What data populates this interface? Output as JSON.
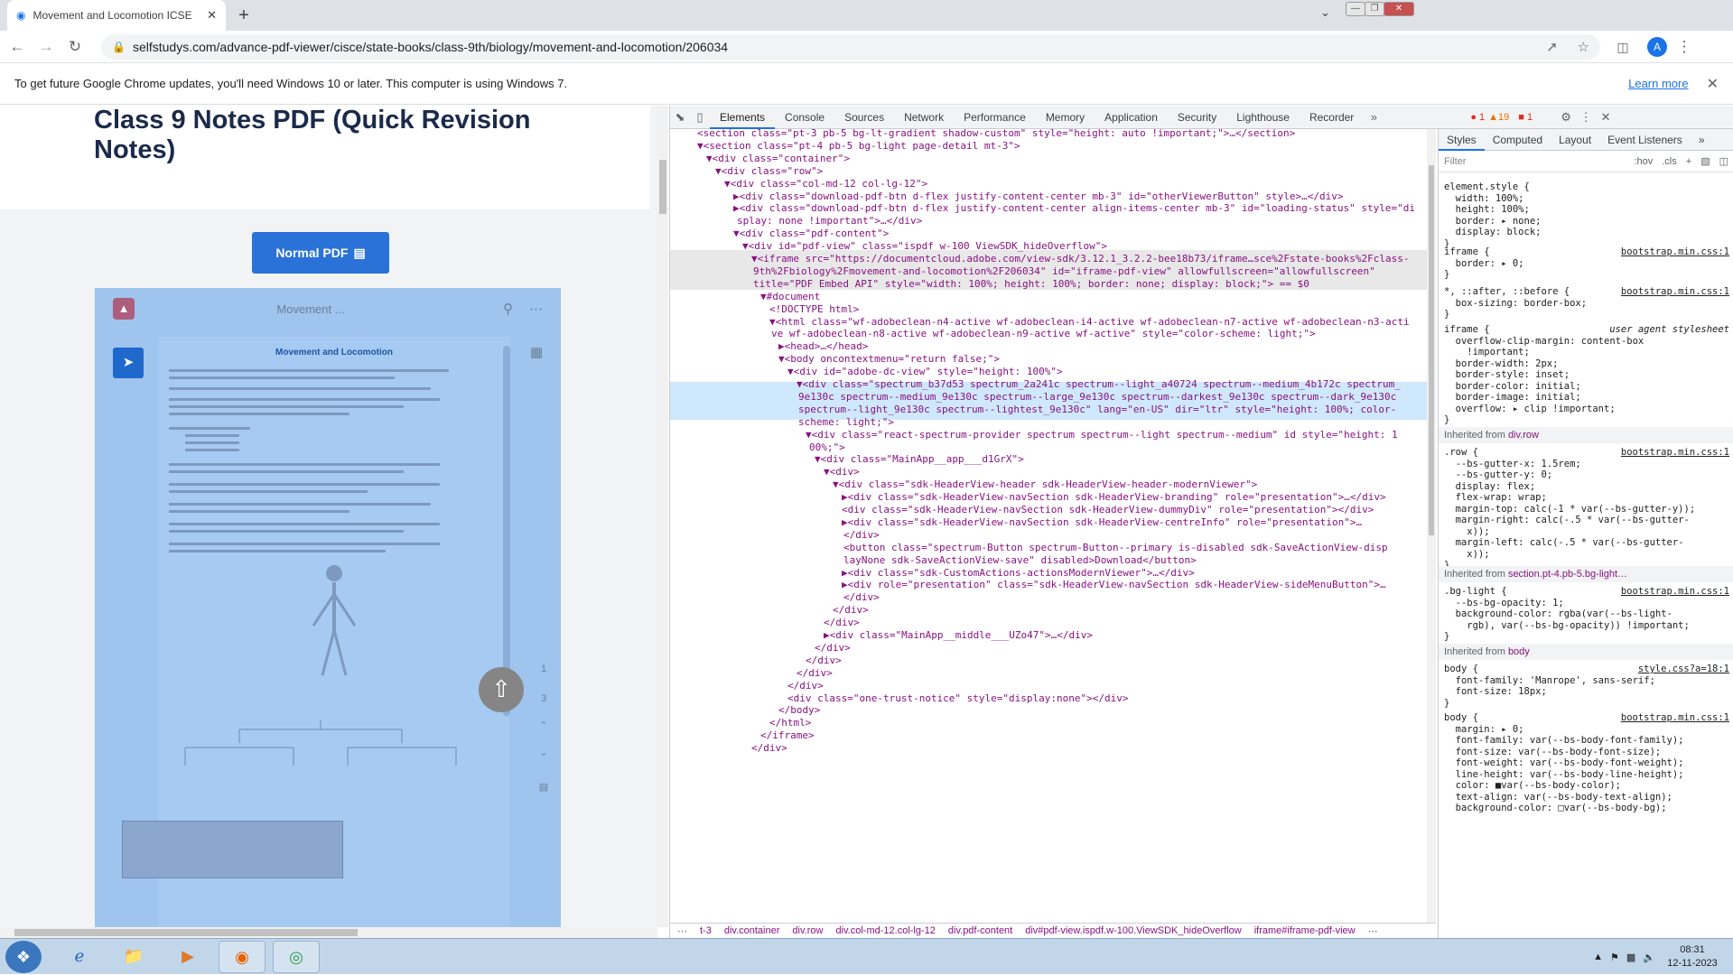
{
  "tab": {
    "title": "Movement and Locomotion ICSE"
  },
  "address": {
    "url": "selfstudys.com/advance-pdf-viewer/cisce/state-books/class-9th/biology/movement-and-locomotion/206034"
  },
  "profile": {
    "initial": "A"
  },
  "infobar": {
    "message": "To get future Google Chrome updates, you'll need Windows 10 or later. This computer is using Windows 7.",
    "link": "Learn more"
  },
  "page": {
    "title": "Class 9 Notes PDF (Quick Revision Notes)",
    "button": "Normal PDF",
    "viewer": {
      "doc_title": "Movement ...",
      "pdf_heading": "Movement and Locomotion",
      "pages": [
        "1",
        "3"
      ]
    }
  },
  "devtools": {
    "tabs": [
      "Elements",
      "Console",
      "Sources",
      "Network",
      "Performance",
      "Memory",
      "Application",
      "Security",
      "Lighthouse",
      "Recorder"
    ],
    "issues": {
      "errors": "1",
      "warnings": "19",
      "messages": "1"
    },
    "code_lines": [
      "<section class=\"pt-3 pb-5 bg-lt-gradient shadow-custom\" style=\"height: auto !important;\">…</section>",
      "▼<section class=\"pt-4 pb-5 bg-light page-detail mt-3\">",
      "▼<div class=\"container\">",
      "▼<div class=\"row\">",
      "▼<div class=\"col-md-12 col-lg-12\">",
      "▶<div class=\"download-pdf-btn d-flex justify-content-center mb-3\" id=\"otherViewerButton\" style>…</div>",
      "▶<div class=\"download-pdf-btn d-flex justify-content-center align-items-center mb-3\" id=\"loading-status\" style=\"di",
      "splay: none !important\">…</div>",
      "▼<div class=\"pdf-content\">",
      "▼<div id=\"pdf-view\" class=\"ispdf w-100 ViewSDK_hideOverflow\">",
      "▼<iframe src=\"https://documentcloud.adobe.com/view-sdk/3.12.1_3.2.2-bee18b73/iframe…sce%2Fstate-books%2Fclass-",
      "9th%2Fbiology%2Fmovement-and-locomotion%2F206034\" id=\"iframe-pdf-view\" allowfullscreen=\"allowfullscreen\"",
      "title=\"PDF Embed API\" style=\"width: 100%; height: 100%; border: none; display: block;\"> == $0",
      "▼#document",
      "<!DOCTYPE html>",
      "▼<html class=\"wf-adobeclean-n4-active wf-adobeclean-i4-active wf-adobeclean-n7-active wf-adobeclean-n3-acti",
      "ve wf-adobeclean-n8-active wf-adobeclean-n9-active wf-active\" style=\"color-scheme: light;\">",
      "▶<head>…</head>",
      "▼<body oncontextmenu=\"return false;\">",
      "▼<div id=\"adobe-dc-view\" style=\"height: 100%\">",
      "▼<div class=\"spectrum_b37d53 spectrum_2a241c spectrum--light_a40724 spectrum--medium_4b172c spectrum_",
      "9e130c spectrum--medium_9e130c spectrum--large_9e130c spectrum--darkest_9e130c spectrum--dark_9e130c",
      "spectrum--light_9e130c spectrum--lightest_9e130c\" lang=\"en-US\" dir=\"ltr\" style=\"height: 100%; color-",
      "scheme: light;\">",
      "▼<div class=\"react-spectrum-provider spectrum spectrum--light spectrum--medium\" id style=\"height: 1",
      "00%;\">",
      "▼<div class=\"MainApp__app___d1GrX\">",
      "▼<div>",
      "▼<div class=\"sdk-HeaderView-header sdk-HeaderView-header-modernViewer\">",
      "▶<div class=\"sdk-HeaderView-navSection sdk-HeaderView-branding\" role=\"presentation\">…</div>",
      "<div class=\"sdk-HeaderView-navSection sdk-HeaderView-dummyDiv\" role=\"presentation\"></div>",
      "▶<div class=\"sdk-HeaderView-navSection sdk-HeaderView-centreInfo\" role=\"presentation\">…",
      "</div>",
      "<button class=\"spectrum-Button spectrum-Button--primary is-disabled sdk-SaveActionView-disp",
      "layNone sdk-SaveActionView-save\" disabled>Download</button>",
      "▶<div class=\"sdk-CustomActions-actionsModernViewer\">…</div>",
      "▶<div role=\"presentation\" class=\"sdk-HeaderView-navSection sdk-HeaderView-sideMenuButton\">…",
      "</div>",
      "</div>",
      "</div>",
      "▶<div class=\"MainApp__middle___UZo47\">…</div>",
      "</div>",
      "</div>",
      "</div>",
      "</div>",
      "<div class=\"one-trust-notice\" style=\"display:none\"></div>",
      "</body>",
      "</html>",
      "</iframe>",
      "</div>"
    ],
    "breadcrumbs": [
      "t-3",
      "div.container",
      "div.row",
      "div.col-md-12.col-lg-12",
      "div.pdf-content",
      "div#pdf-view.ispdf.w-100.ViewSDK_hideOverflow",
      "iframe#iframe-pdf-view"
    ],
    "styles_tabs": [
      "Styles",
      "Computed",
      "Layout",
      "Event Listeners"
    ],
    "filter_placeholder": "Filter",
    "filter_hov": ":hov",
    "filter_cls": ".cls",
    "rules": {
      "element_style": "element.style {\n  width: 100%;\n  height: 100%;\n  border: ▸ none;\n  display: block;\n}",
      "iframe_bs": "iframe {\n  border: ▸ 0;\n}",
      "universal_bs": "*, ::after, ::before {\n  box-sizing: border-box;\n}",
      "iframe_ua": "iframe {\n  overflow-clip-margin: content-box\n    !important;\n  border-width: 2px;\n  border-style: inset;\n  border-color: initial;\n  border-image: initial;\n  overflow: ▸ clip !important;\n}",
      "row_rule": ".row {\n  --bs-gutter-x: 1.5rem;\n  --bs-gutter-y: 0;\n  display: flex;\n  flex-wrap: wrap;\n  margin-top: calc(-1 * var(--bs-gutter-y));\n  margin-right: calc(-.5 * var(--bs-gutter-\n    x));\n  margin-left: calc(-.5 * var(--bs-gutter-\n    x));\n}",
      "bglight_rule": ".bg-light {\n  --bs-bg-opacity: 1;\n  background-color: rgba(var(--bs-light-\n    rgb), var(--bs-bg-opacity)) !important;\n}",
      "body_style": "body {\n  font-family: 'Manrope', sans-serif;\n  font-size: 18px;\n}",
      "body_bs": "body {\n  margin: ▸ 0;\n  font-family: var(--bs-body-font-family);\n  font-size: var(--bs-body-font-size);\n  font-weight: var(--bs-body-font-weight);\n  line-height: var(--bs-body-line-height);\n  color: ■var(--bs-body-color);\n  text-align: var(--bs-body-text-align);\n  background-color: □var(--bs-body-bg);"
    },
    "sources": {
      "bootstrap": "bootstrap.min.css:1",
      "ua": "user agent stylesheet",
      "style": "style.css?a=18:1"
    },
    "inherited": {
      "row_label": "Inherited from",
      "row_ref": "div.row",
      "section_ref": "section.pt-4.pb-5.bg-light…",
      "body_ref": "body"
    }
  },
  "taskbar": {
    "time": "08:31",
    "date": "12-11-2023"
  }
}
